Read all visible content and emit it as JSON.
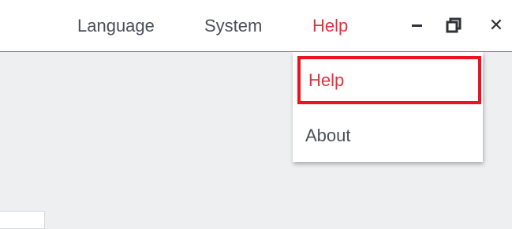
{
  "menubar": {
    "items": [
      {
        "label": "Language"
      },
      {
        "label": "System"
      },
      {
        "label": "Help",
        "active": true
      }
    ]
  },
  "window_controls": {
    "minimize_icon": "minimize-icon",
    "restore_icon": "restore-icon",
    "close_icon": "close-icon",
    "close_glyph": "✕"
  },
  "help_menu": {
    "items": [
      {
        "label": "Help",
        "highlighted": true
      },
      {
        "label": "About"
      }
    ]
  },
  "colors": {
    "accent": "#e62e3d",
    "highlight_border": "#f0111f",
    "text": "#4a4f57",
    "background": "#eeeff1"
  }
}
